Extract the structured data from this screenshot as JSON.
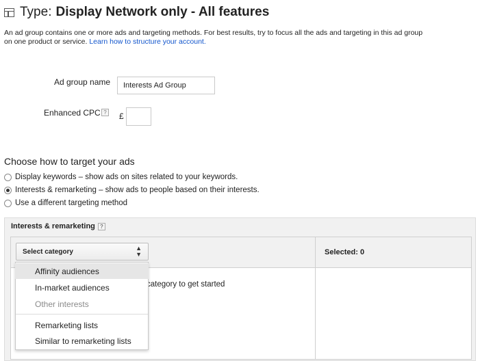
{
  "header": {
    "type_prefix": "Type:",
    "type_value": "Display Network only - All features"
  },
  "intro": {
    "text": "An ad group contains one or more ads and targeting methods. For best results, try to focus all the ads and targeting in this ad group on one product or service. ",
    "link": "Learn how to structure your account."
  },
  "form": {
    "ad_group_name_label": "Ad group name",
    "ad_group_name_value": "Interests Ad Group",
    "enhanced_cpc_label": "Enhanced CPC",
    "help_glyph": "?",
    "currency": "£",
    "cpc_value": ""
  },
  "targeting": {
    "title": "Choose how to target your ads",
    "options": [
      {
        "label": "Display keywords – show ads on sites related to your keywords.",
        "checked": false
      },
      {
        "label": "Interests & remarketing – show ads to people based on their interests.",
        "checked": true
      },
      {
        "label": "Use a different targeting method",
        "checked": false
      }
    ]
  },
  "panel": {
    "title": "Interests & remarketing",
    "select_label": "Select category",
    "selected_label": "Selected: 0",
    "get_started_text": "category to get started",
    "dropdown": [
      {
        "label": "Affinity audiences",
        "highlighted": true,
        "disabled": false
      },
      {
        "label": "In-market audiences",
        "highlighted": false,
        "disabled": false
      },
      {
        "label": "Other interests",
        "highlighted": false,
        "disabled": true
      },
      {
        "label": "Remarketing lists",
        "highlighted": false,
        "disabled": false
      },
      {
        "label": "Similar to remarketing lists",
        "highlighted": false,
        "disabled": false
      }
    ]
  },
  "icons": {
    "type_icon": "layout-grid-icon",
    "help_icon": "help-question-icon",
    "select_caret": "updown-caret-icon"
  },
  "colors": {
    "link": "#1155cc",
    "panel_bg": "#f1f1f1",
    "highlight": "#e6e6e6"
  }
}
